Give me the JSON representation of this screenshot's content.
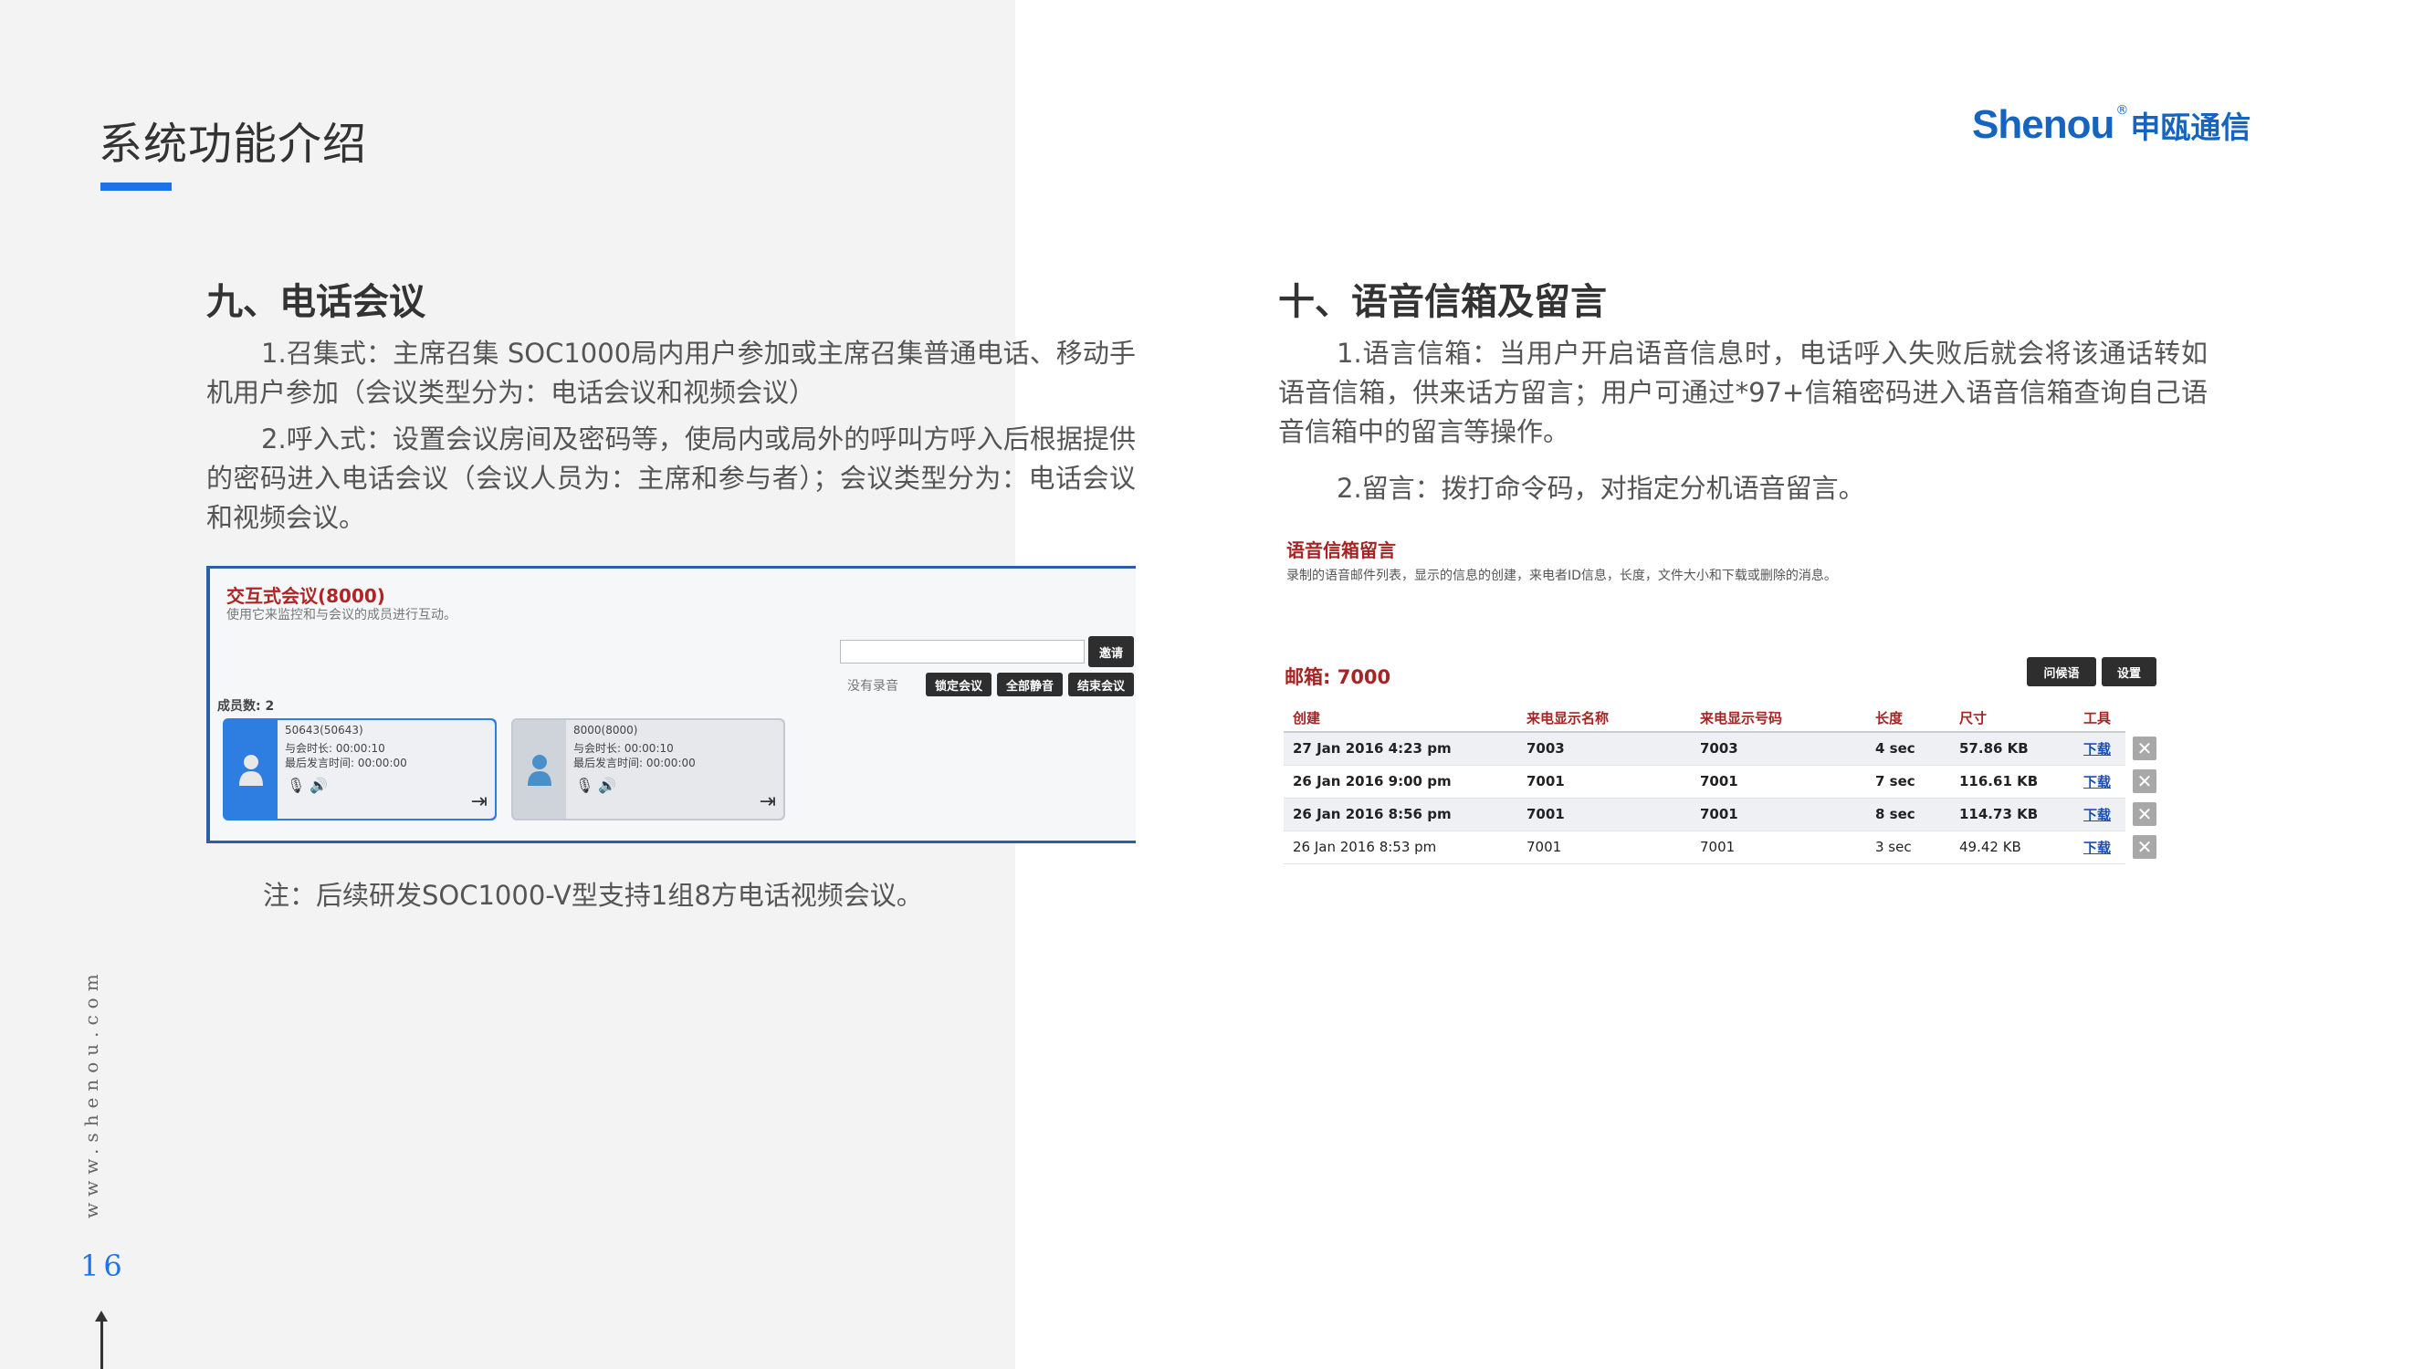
{
  "header": {
    "title": "系统功能介绍",
    "brand_en": "Shenou",
    "brand_reg": "®",
    "brand_cn": "申瓯通信"
  },
  "sidebar": {
    "url": "www.shenou.com",
    "page_number": "16"
  },
  "section9": {
    "heading": "九、电话会议",
    "p1": "1.召集式：主席召集 SOC1000局内用户参加或主席召集普通电话、移动手机用户参加（会议类型分为：电话会议和视频会议）",
    "p2": "2.呼入式：设置会议房间及密码等，使局内或局外的呼叫方呼入后根据提供的密码进入电话会议（会议人员为：主席和参与者）；会议类型分为：电话会议和视频会议。",
    "note": "注：后续研发SOC1000-V型支持1组8方电话视频会议。"
  },
  "conference": {
    "title": "交互式会议(8000)",
    "description": "使用它来监控和与会议的成员进行互动。",
    "invite_btn": "邀请",
    "no_recording": "没有录音",
    "lock_btn": "锁定会议",
    "mute_all_btn": "全部静音",
    "end_btn": "结束会议",
    "member_count": "成员数: 2",
    "members": [
      {
        "name": "50643(50643)",
        "duration": "与会时长: 00:00:10",
        "last_speak": "最后发言时间: 00:00:00"
      },
      {
        "name": "8000(8000)",
        "duration": "与会时长: 00:00:10",
        "last_speak": "最后发言时间: 00:00:00"
      }
    ]
  },
  "section10": {
    "heading": "十、语音信箱及留言",
    "p1": "1.语言信箱：当用户开启语音信息时，电话呼入失败后就会将该通话转如语音信箱，供来话方留言；用户可通过*97+信箱密码进入语音信箱查询自己语音信箱中的留言等操作。",
    "p2": "2.留言：拨打命令码，对指定分机语音留言。"
  },
  "voicemail": {
    "title": "语音信箱留言",
    "description": "录制的语音邮件列表，显示的信息的创建，来电者ID信息，长度，文件大小和下载或删除的消息。",
    "mailbox": "邮箱: 7000",
    "greeting_btn": "问候语",
    "settings_btn": "设置",
    "columns": [
      "创建",
      "来电显示名称",
      "来电显示号码",
      "长度",
      "尺寸",
      "工具"
    ],
    "rows": [
      {
        "created": "27 Jan 2016 4:23 pm",
        "caller_name": "7003",
        "caller_number": "7003",
        "length": "4 sec",
        "size": "57.86 KB",
        "tool": "下载"
      },
      {
        "created": "26 Jan 2016 9:00 pm",
        "caller_name": "7001",
        "caller_number": "7001",
        "length": "7 sec",
        "size": "116.61 KB",
        "tool": "下载"
      },
      {
        "created": "26 Jan 2016 8:56 pm",
        "caller_name": "7001",
        "caller_number": "7001",
        "length": "8 sec",
        "size": "114.73 KB",
        "tool": "下载"
      },
      {
        "created": "26 Jan 2016 8:53 pm",
        "caller_name": "7001",
        "caller_number": "7001",
        "length": "3 sec",
        "size": "49.42 KB",
        "tool": "下载"
      }
    ],
    "delete_glyph": "✕"
  }
}
